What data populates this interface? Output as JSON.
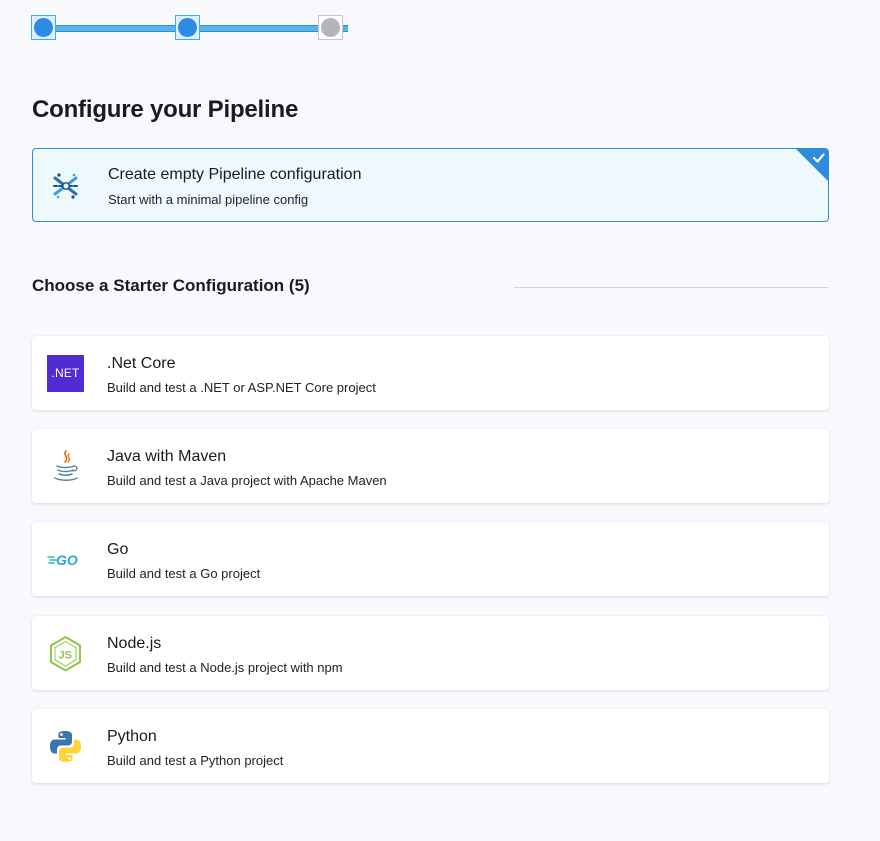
{
  "stepper": {
    "steps": [
      "completed",
      "active",
      "pending"
    ],
    "colors": {
      "active": "#2e8ae8",
      "line": "#56b4e9",
      "pending": "#b4b4be"
    }
  },
  "page_title": "Configure your Pipeline",
  "empty_pipeline": {
    "title": "Create empty Pipeline configuration",
    "subtitle": "Start with a minimal pipeline config",
    "selected": true,
    "icon": "pipeline-icon"
  },
  "starter_section": {
    "title": "Choose a Starter Configuration (5)"
  },
  "starters": [
    {
      "name": ".Net Core",
      "description": "Build and test a .NET or ASP.NET Core project",
      "icon": "dotnet-logo",
      "logo_text": ".NET"
    },
    {
      "name": "Java with Maven",
      "description": "Build and test a Java project with Apache Maven",
      "icon": "java-logo"
    },
    {
      "name": "Go",
      "description": "Build and test a Go project",
      "icon": "go-logo",
      "logo_text": "GO"
    },
    {
      "name": "Node.js",
      "description": "Build and test a Node.js project with npm",
      "icon": "nodejs-logo",
      "logo_text": "JS"
    },
    {
      "name": "Python",
      "description": "Build and test a Python project",
      "icon": "python-logo"
    }
  ],
  "colors": {
    "accent": "#2f8bdc",
    "selected_bg": "#eef9fd",
    "page_bg": "#f8f9fd",
    "dotnet": "#512bd4",
    "node": "#8cc84b",
    "go": "#29beb0"
  }
}
